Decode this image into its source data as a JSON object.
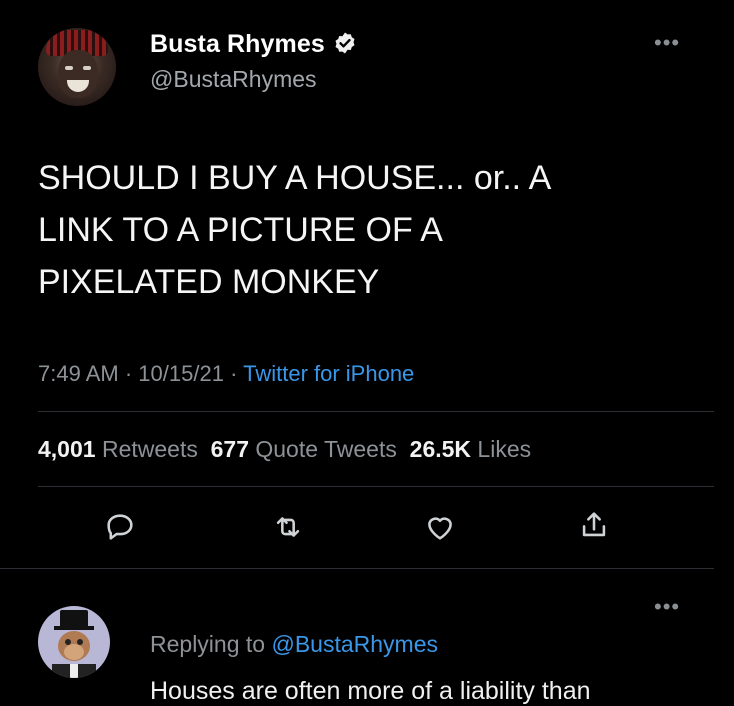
{
  "author": {
    "display_name": "Busta Rhymes",
    "handle": "@BustaRhymes",
    "verified_icon": "verified-badge-icon"
  },
  "tweet": {
    "text_lines": [
      "SHOULD I BUY A HOUSE... or.. A",
      "LINK TO A PICTURE OF A",
      "PIXELATED MONKEY"
    ],
    "time": "7:49 AM",
    "date": "10/15/21",
    "separator": "·",
    "source": "Twitter for iPhone"
  },
  "stats": {
    "retweets_count": "4,001",
    "retweets_label": "Retweets",
    "quotes_count": "677",
    "quotes_label": "Quote Tweets",
    "likes_count": "26.5K",
    "likes_label": "Likes"
  },
  "actions": {
    "reply_icon": "reply-icon",
    "retweet_icon": "retweet-icon",
    "like_icon": "heart-icon",
    "share_icon": "share-icon"
  },
  "more_icon": "more-dots-icon",
  "reply": {
    "replying_prefix": "Replying to",
    "replying_handle": "@BustaRhymes",
    "text": "Houses are often more of a liability than"
  },
  "colors": {
    "background": "#000000",
    "link_blue": "#3a97e8",
    "muted_gray": "#8d9297"
  }
}
